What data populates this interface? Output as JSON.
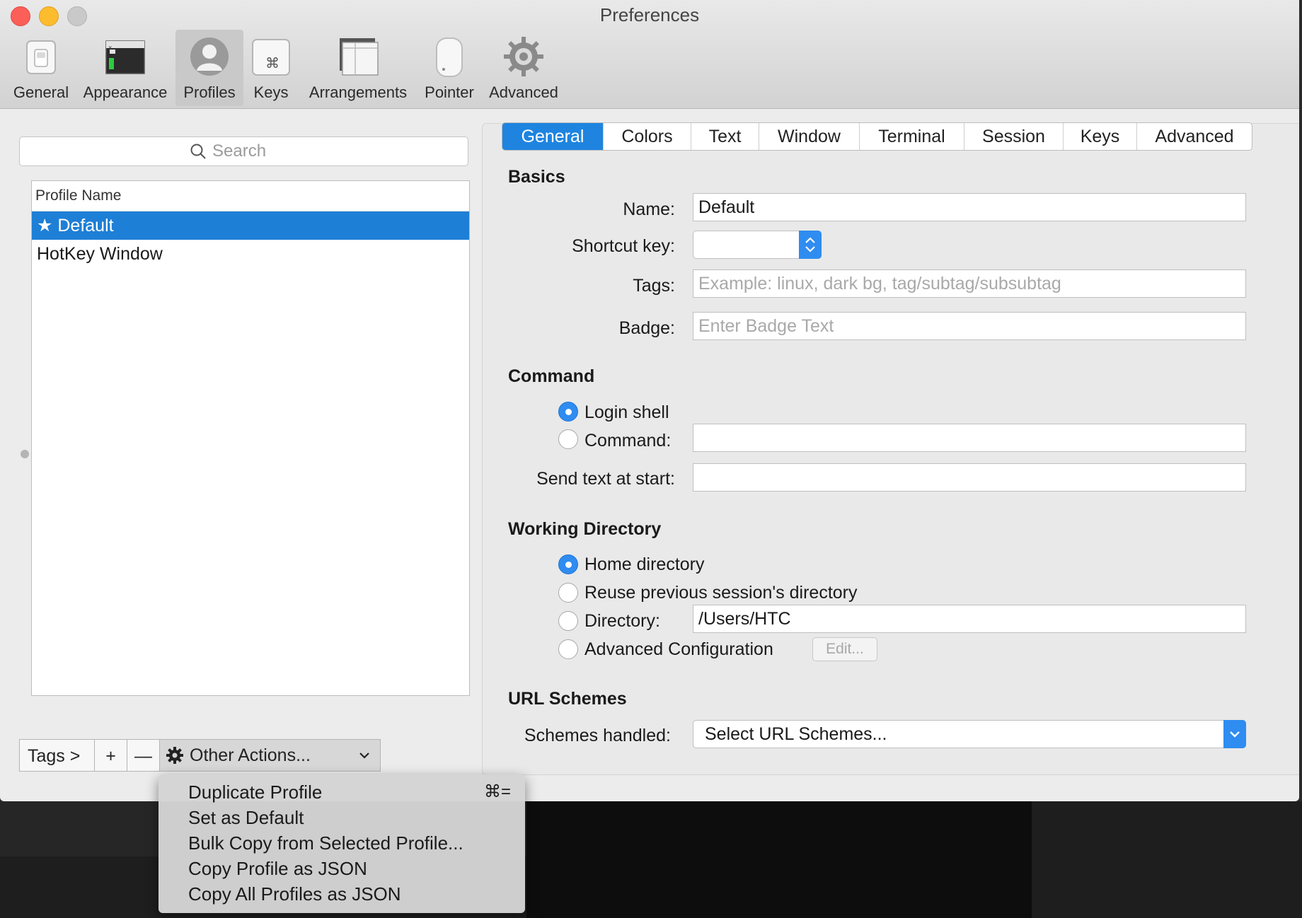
{
  "window": {
    "title": "Preferences"
  },
  "toolbar": {
    "items": [
      {
        "label": "General",
        "icon": "switch-icon"
      },
      {
        "label": "Appearance",
        "icon": "terminal-window-icon"
      },
      {
        "label": "Profiles",
        "icon": "user-silhouette-icon",
        "selected": true
      },
      {
        "label": "Keys",
        "icon": "command-key-icon"
      },
      {
        "label": "Arrangements",
        "icon": "window-arrangement-icon"
      },
      {
        "label": "Pointer",
        "icon": "mouse-icon"
      },
      {
        "label": "Advanced",
        "icon": "gear-icon"
      }
    ]
  },
  "sidebar": {
    "search_placeholder": "Search",
    "list_header": "Profile Name",
    "profiles": [
      {
        "label": "★ Default",
        "selected": true
      },
      {
        "label": "HotKey Window",
        "selected": false
      }
    ],
    "bottom": {
      "tags": "Tags >",
      "add": "+",
      "remove": "—",
      "other_actions": "Other Actions..."
    }
  },
  "tabs": {
    "items": [
      "General",
      "Colors",
      "Text",
      "Window",
      "Terminal",
      "Session",
      "Keys",
      "Advanced"
    ],
    "active": "General"
  },
  "basics": {
    "title": "Basics",
    "name_label": "Name:",
    "name_value": "Default",
    "shortcut_label": "Shortcut key:",
    "tags_label": "Tags:",
    "tags_placeholder": "Example: linux, dark bg, tag/subtag/subsubtag",
    "badge_label": "Badge:",
    "badge_placeholder": "Enter Badge Text"
  },
  "command": {
    "title": "Command",
    "login_shell": "Login shell",
    "command_label": "Command:",
    "command_value": "",
    "send_text_label": "Send text at start:",
    "send_text_value": "",
    "selected": "login_shell"
  },
  "working_directory": {
    "title": "Working Directory",
    "home": "Home directory",
    "reuse": "Reuse previous session's directory",
    "directory_label": "Directory:",
    "directory_value": "/Users/HTC",
    "advanced": "Advanced Configuration",
    "edit": "Edit...",
    "selected": "home"
  },
  "url_schemes": {
    "title": "URL Schemes",
    "label": "Schemes handled:",
    "value": "Select URL Schemes..."
  },
  "context_menu": {
    "items": [
      {
        "label": "Duplicate Profile",
        "shortcut": "⌘="
      },
      {
        "label": "Set as Default"
      },
      {
        "label": "Bulk Copy from Selected Profile..."
      },
      {
        "label": "Copy Profile as JSON"
      },
      {
        "label": "Copy All Profiles as JSON"
      }
    ]
  },
  "colors": {
    "accent": "#1e84e0",
    "selection": "#1e7fd6",
    "close": "#fc5f57",
    "minimize": "#fdbc2e"
  }
}
